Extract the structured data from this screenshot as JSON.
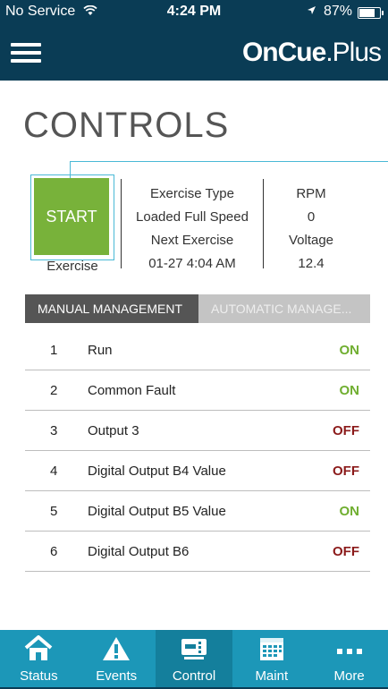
{
  "status_bar": {
    "carrier": "No Service",
    "time": "4:24 PM",
    "battery": "87%",
    "battery_level": 0.87
  },
  "header": {
    "logo_main": "OnCue",
    "logo_suffix": "Plus"
  },
  "page": {
    "title": "CONTROLS"
  },
  "exercise": {
    "start_label": "START",
    "caption": "Exercise",
    "type_label": "Exercise Type",
    "type_value": "Loaded Full Speed",
    "next_label": "Next Exercise",
    "next_value": "01-27 4:04 AM",
    "rpm_label": "RPM",
    "rpm_value": "0",
    "voltage_label": "Voltage",
    "voltage_value": "12.4"
  },
  "tabs": [
    {
      "label": "MANUAL MANAGEMENT",
      "active": true
    },
    {
      "label": "AUTOMATIC MANAGE...",
      "active": false
    }
  ],
  "outputs": [
    {
      "num": "1",
      "name": "Run",
      "state": "ON"
    },
    {
      "num": "2",
      "name": "Common Fault",
      "state": "ON"
    },
    {
      "num": "3",
      "name": "Output 3",
      "state": "OFF"
    },
    {
      "num": "4",
      "name": "Digital Output B4 Value",
      "state": "OFF"
    },
    {
      "num": "5",
      "name": "Digital Output B5 Value",
      "state": "ON"
    },
    {
      "num": "6",
      "name": "Digital Output B6",
      "state": "OFF"
    }
  ],
  "tabbar": [
    {
      "label": "Status",
      "icon": "home-icon"
    },
    {
      "label": "Events",
      "icon": "warning-icon"
    },
    {
      "label": "Control",
      "icon": "control-panel-icon",
      "selected": true
    },
    {
      "label": "Maint",
      "icon": "calendar-icon"
    },
    {
      "label": "More",
      "icon": "more-icon"
    }
  ],
  "colors": {
    "header_bg": "#0a3c55",
    "accent": "#4ab9d6",
    "start_green": "#78b23a",
    "on": "#6fae2f",
    "off": "#8b1a1a",
    "tabbar_bg": "#1c97b8"
  }
}
